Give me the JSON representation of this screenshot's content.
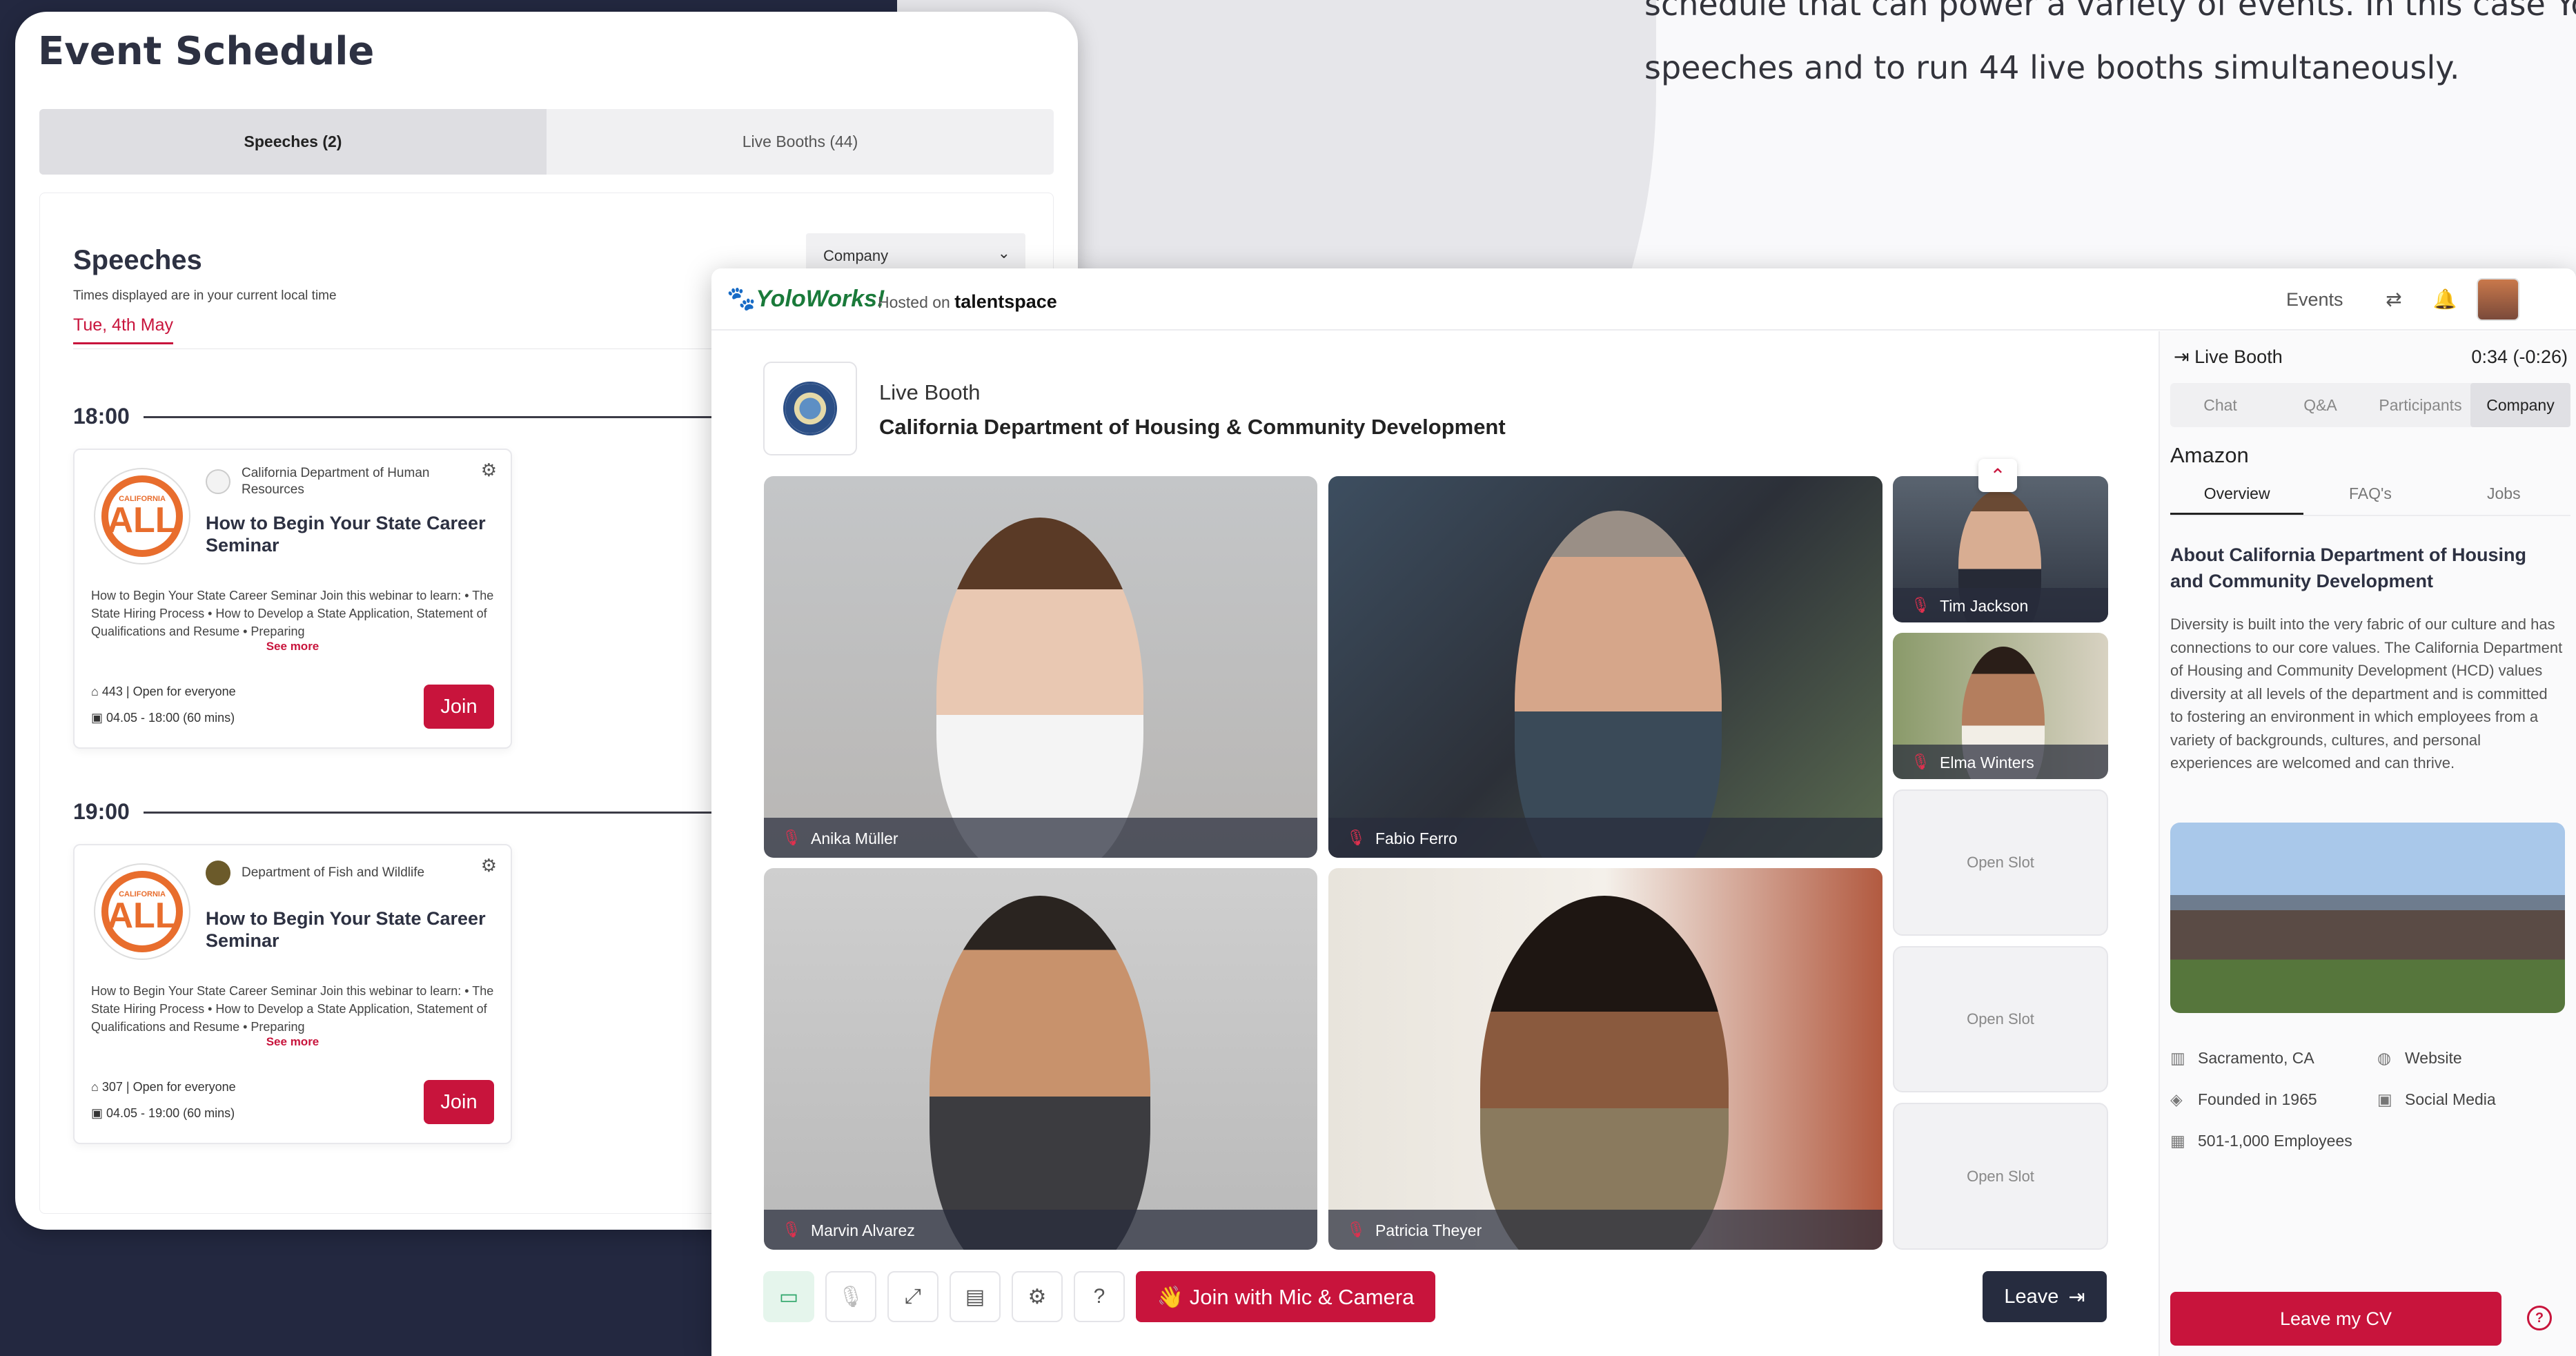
{
  "intro_lines": [
    "schedule that can power a variety of events. In this case Yolow",
    "speeches and to run 44 live booths simultaneously."
  ],
  "schedule": {
    "title": "Event Schedule",
    "tabs": [
      "Speeches (2)",
      "Live Booths (44)"
    ],
    "heading": "Speeches",
    "note": "Times displayed are in your current local time",
    "date": "Tue, 4th May",
    "company_filter": "Company",
    "slots": [
      {
        "time": "18:00",
        "org": "California Department of Human Resources",
        "title": "How to Begin Your State Career Seminar",
        "desc": "How to Begin Your State Career Seminar Join this webinar to learn: • The State Hiring Process • How to Develop a State Application, Statement of Qualifications and Resume • Preparing",
        "see_more": "See more",
        "attendance": "443 | Open for everyone",
        "when": "04.05 - 18:00 (60 mins)",
        "join": "Join",
        "logo_top": "CALIFORNIA",
        "logo_main": "ALL"
      },
      {
        "time": "19:00",
        "org": "Department of Fish and Wildlife",
        "title": "How to Begin Your State Career Seminar",
        "desc": "How to Begin Your State Career Seminar Join this webinar to learn: • The State Hiring Process • How to Develop a State Application, Statement of Qualifications and Resume • Preparing",
        "see_more": "See more",
        "attendance": "307 | Open for everyone",
        "when": "04.05 - 19:00 (60 mins)",
        "join": "Join",
        "logo_top": "CALIFORNIA",
        "logo_main": "ALL"
      }
    ]
  },
  "topbar": {
    "brand": "YoloWorks!",
    "hosted_prefix": "Hosted on",
    "hosted_brand": "talentspace",
    "events": "Events"
  },
  "booth": {
    "kicker": "Live Booth",
    "name": "California Department of Housing & Community Development"
  },
  "participants": [
    "Anika Müller",
    "Fabio Ferro",
    "Marvin Alvarez",
    "Patricia Theyer",
    "Tim Jackson",
    "Elma Winters"
  ],
  "open_slot": "Open Slot",
  "controls": {
    "join_mic": "👋 Join with Mic & Camera",
    "leave": "Leave"
  },
  "panel": {
    "header": "Live Booth",
    "timer": "0:34 (-0:26)",
    "tabs": [
      "Chat",
      "Q&A",
      "Participants",
      "Company"
    ],
    "company": "Amazon",
    "subtabs": [
      "Overview",
      "FAQ's",
      "Jobs"
    ],
    "about_title": "About California Department of Housing and Community Development",
    "about_text": "Diversity is built into the very fabric of our culture and has connections to our core values. The California Department of Housing and Community Development (HCD) values diversity at all levels of the department and is committed to fostering an environment in which employees from a variety of backgrounds, cultures, and personal experiences are welcomed and can thrive.",
    "location": "Sacramento, CA",
    "website": "Website",
    "founded": "Founded in 1965",
    "social": "Social Media",
    "employees": "501-1,000 Employees",
    "leave_cv": "Leave my CV"
  }
}
